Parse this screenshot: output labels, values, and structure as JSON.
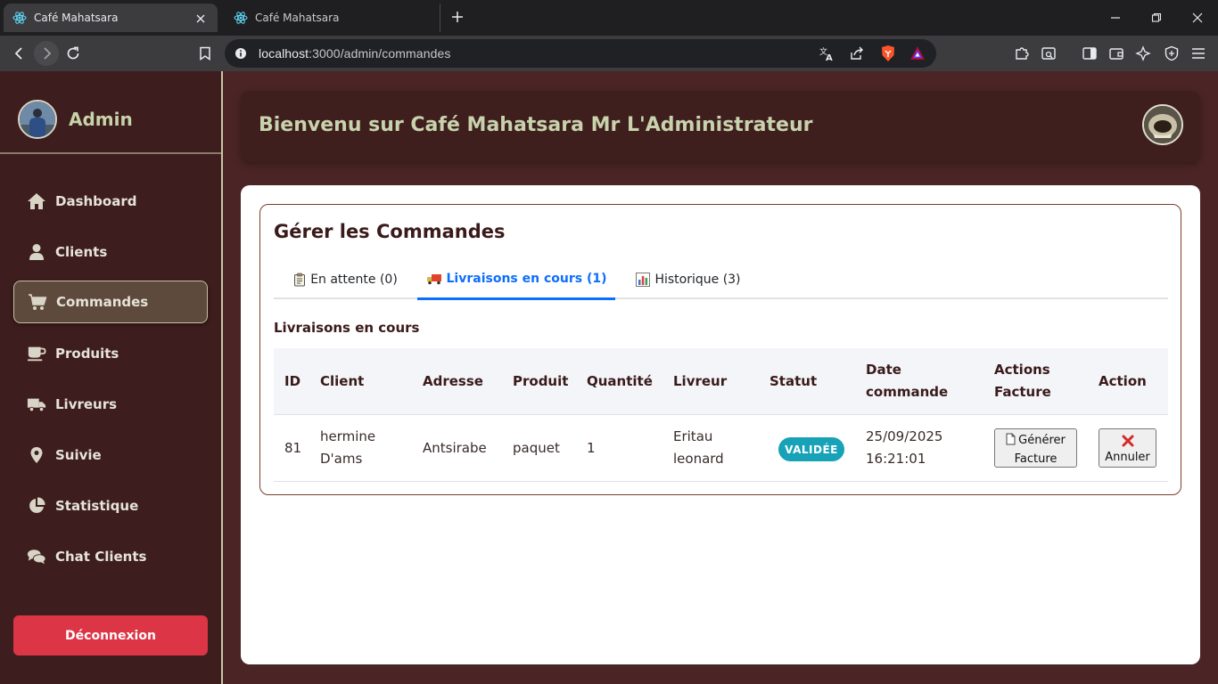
{
  "browser": {
    "tabs": [
      {
        "title": "Café Mahatsara",
        "active": true
      },
      {
        "title": "Café Mahatsara",
        "active": false
      }
    ],
    "url_host": "localhost",
    "url_path": ":3000/admin/commandes"
  },
  "sidebar": {
    "brand": "Admin",
    "items": [
      {
        "label": "Dashboard",
        "icon": "home-icon"
      },
      {
        "label": "Clients",
        "icon": "user-icon"
      },
      {
        "label": "Commandes",
        "icon": "cart-icon",
        "active": true
      },
      {
        "label": "Produits",
        "icon": "mug-icon"
      },
      {
        "label": "Livreurs",
        "icon": "truck-icon"
      },
      {
        "label": "Suivie",
        "icon": "map-pin-icon"
      },
      {
        "label": "Statistique",
        "icon": "pie-chart-icon"
      },
      {
        "label": "Chat Clients",
        "icon": "comments-icon"
      }
    ],
    "logout": "Déconnexion"
  },
  "header": {
    "welcome": "Bienvenu sur Café Mahatsara Mr L'Administrateur"
  },
  "orders": {
    "title": "Gérer les Commandes",
    "tabs": [
      {
        "label": "En attente (0)",
        "icon": "clipboard-icon"
      },
      {
        "label": "Livraisons en cours (1)",
        "icon": "delivery-truck-icon",
        "active": true
      },
      {
        "label": "Historique (3)",
        "icon": "bar-chart-icon"
      }
    ],
    "section_title": "Livraisons en cours",
    "columns": {
      "id": "ID",
      "client": "Client",
      "adresse": "Adresse",
      "produit": "Produit",
      "quantite": "Quantité",
      "livreur": "Livreur",
      "statut": "Statut",
      "date_1": "Date",
      "date_2": "commande",
      "actions_1": "Actions",
      "actions_2": "Facture",
      "action": "Action"
    },
    "rows": [
      {
        "id": "81",
        "client_1": "hermine",
        "client_2": "D'ams",
        "adresse": "Antsirabe",
        "produit": "paquet",
        "quantite": "1",
        "livreur_1": "Eritau",
        "livreur_2": "leonard",
        "statut": "VALIDÉE",
        "date_1": "25/09/2025",
        "date_2": "16:21:01",
        "generate_1": "Générer",
        "generate_2": "Facture",
        "cancel": "Annuler"
      }
    ]
  },
  "colors": {
    "sidebar_bg": "#3d1d1d",
    "page_bg": "#4b2525",
    "accent_green": "#c8d2ac",
    "active_tab": "#0d6efd",
    "badge": "#17a2b8",
    "logout": "#dc3545"
  }
}
